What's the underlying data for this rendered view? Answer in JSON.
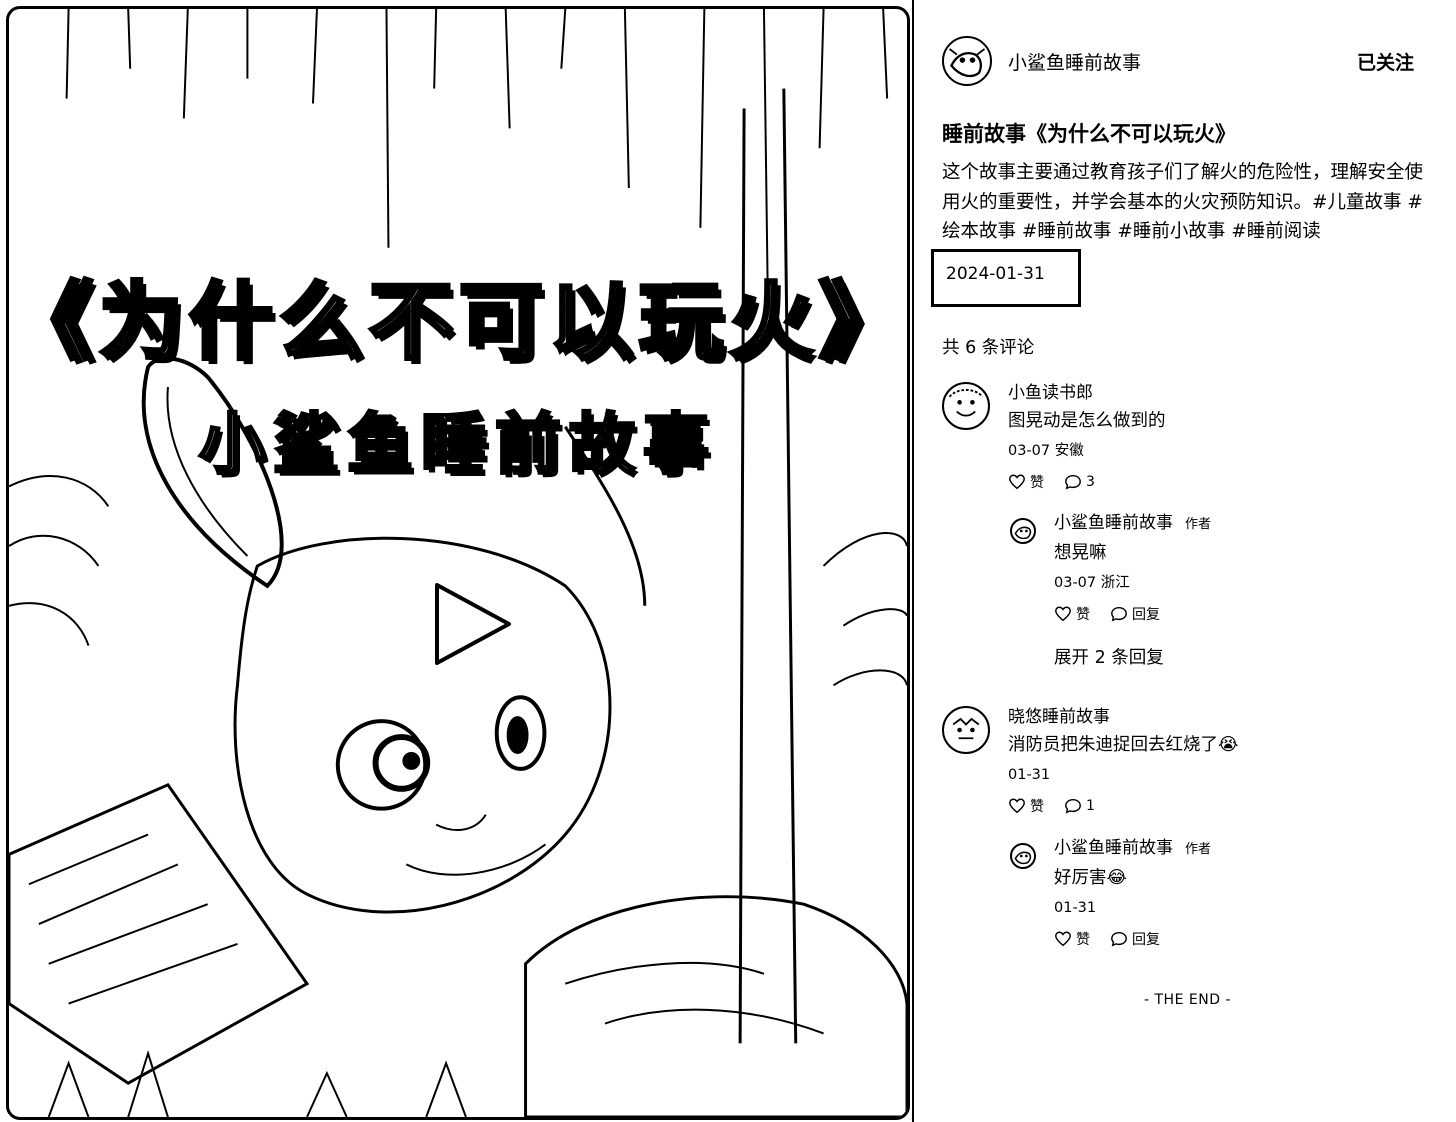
{
  "cover": {
    "title": "《为什么不可以玩火》",
    "subtitle": "小鲨鱼睡前故事"
  },
  "post": {
    "author": "小鲨鱼睡前故事",
    "follow_label": "已关注",
    "title": "睡前故事《为什么不可以玩火》",
    "description": "这个故事主要通过教育孩子们了解火的危险性，理解安全使用火的重要性，并学会基本的火灾预防知识。",
    "tags": [
      "#儿童故事",
      "#绘本故事",
      "#睡前故事",
      "#睡前小故事",
      "#睡前阅读"
    ],
    "date": "2024-01-31",
    "comment_count": "共 6 条评论"
  },
  "comments": [
    {
      "name": "小鱼读书郎",
      "text": "图晃动是怎么做到的",
      "meta": "03-07 安徽",
      "like_label": "赞",
      "reply_count": "3",
      "replies": [
        {
          "name": "小鲨鱼睡前故事",
          "badge": "作者",
          "text": "想晃嘛",
          "meta": "03-07 浙江",
          "like_label": "赞",
          "reply_label": "回复"
        }
      ],
      "expand_label": "展开 2 条回复"
    },
    {
      "name": "晓悠睡前故事",
      "text": "消防员把朱迪捉回去红烧了😭",
      "meta": "01-31",
      "like_label": "赞",
      "reply_count": "1",
      "replies": [
        {
          "name": "小鲨鱼睡前故事",
          "badge": "作者",
          "text": "好厉害😂",
          "meta": "01-31",
          "like_label": "赞",
          "reply_label": "回复"
        }
      ]
    }
  ],
  "footer": {
    "end_label": "- THE END -"
  },
  "icons": {
    "play": "play-icon",
    "like": "heart-icon",
    "comment": "speech-bubble-icon"
  }
}
